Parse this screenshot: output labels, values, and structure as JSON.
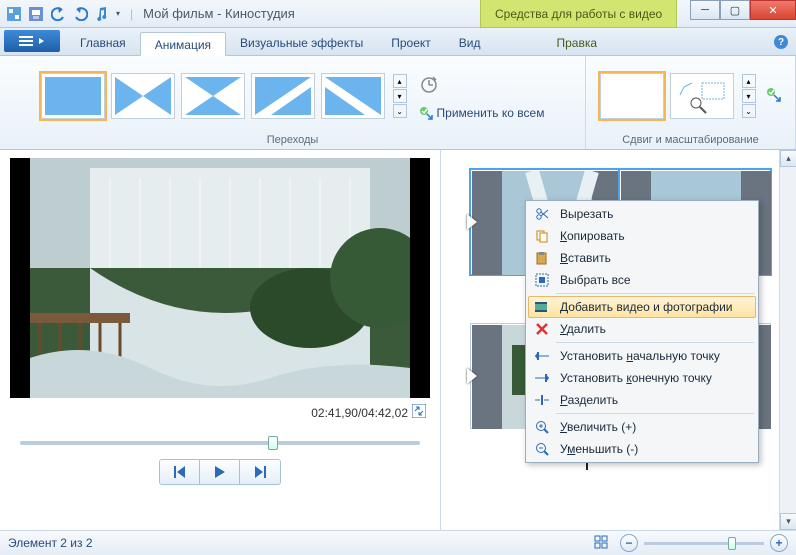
{
  "title": "Мой фильм - Киностудия",
  "context_tab": "Средства для работы с видео",
  "tabs": {
    "home": "Главная",
    "animation": "Анимация",
    "effects": "Визуальные эффекты",
    "project": "Проект",
    "view": "Вид",
    "edit": "Правка"
  },
  "ribbon": {
    "apply_all": "Применить ко всем",
    "group_transitions": "Переходы",
    "group_panzoom": "Сдвиг и масштабирование"
  },
  "player": {
    "timecode": "02:41,90/04:42,02",
    "position_pct": 62
  },
  "context_menu": {
    "cut": "Вырезать",
    "copy": "Копировать",
    "paste": "Вставить",
    "select_all": "Выбрать все",
    "add_media": "Добавить видео и фотографии",
    "delete": "Удалить",
    "set_start": "Установить начальную точку",
    "set_end": "Установить конечную точку",
    "split": "Разделить",
    "zoom_in": "Увеличить (+)",
    "zoom_out": "Уменьшить (-)"
  },
  "status": {
    "item_count": "Элемент 2 из 2",
    "zoom_pct": 70
  }
}
